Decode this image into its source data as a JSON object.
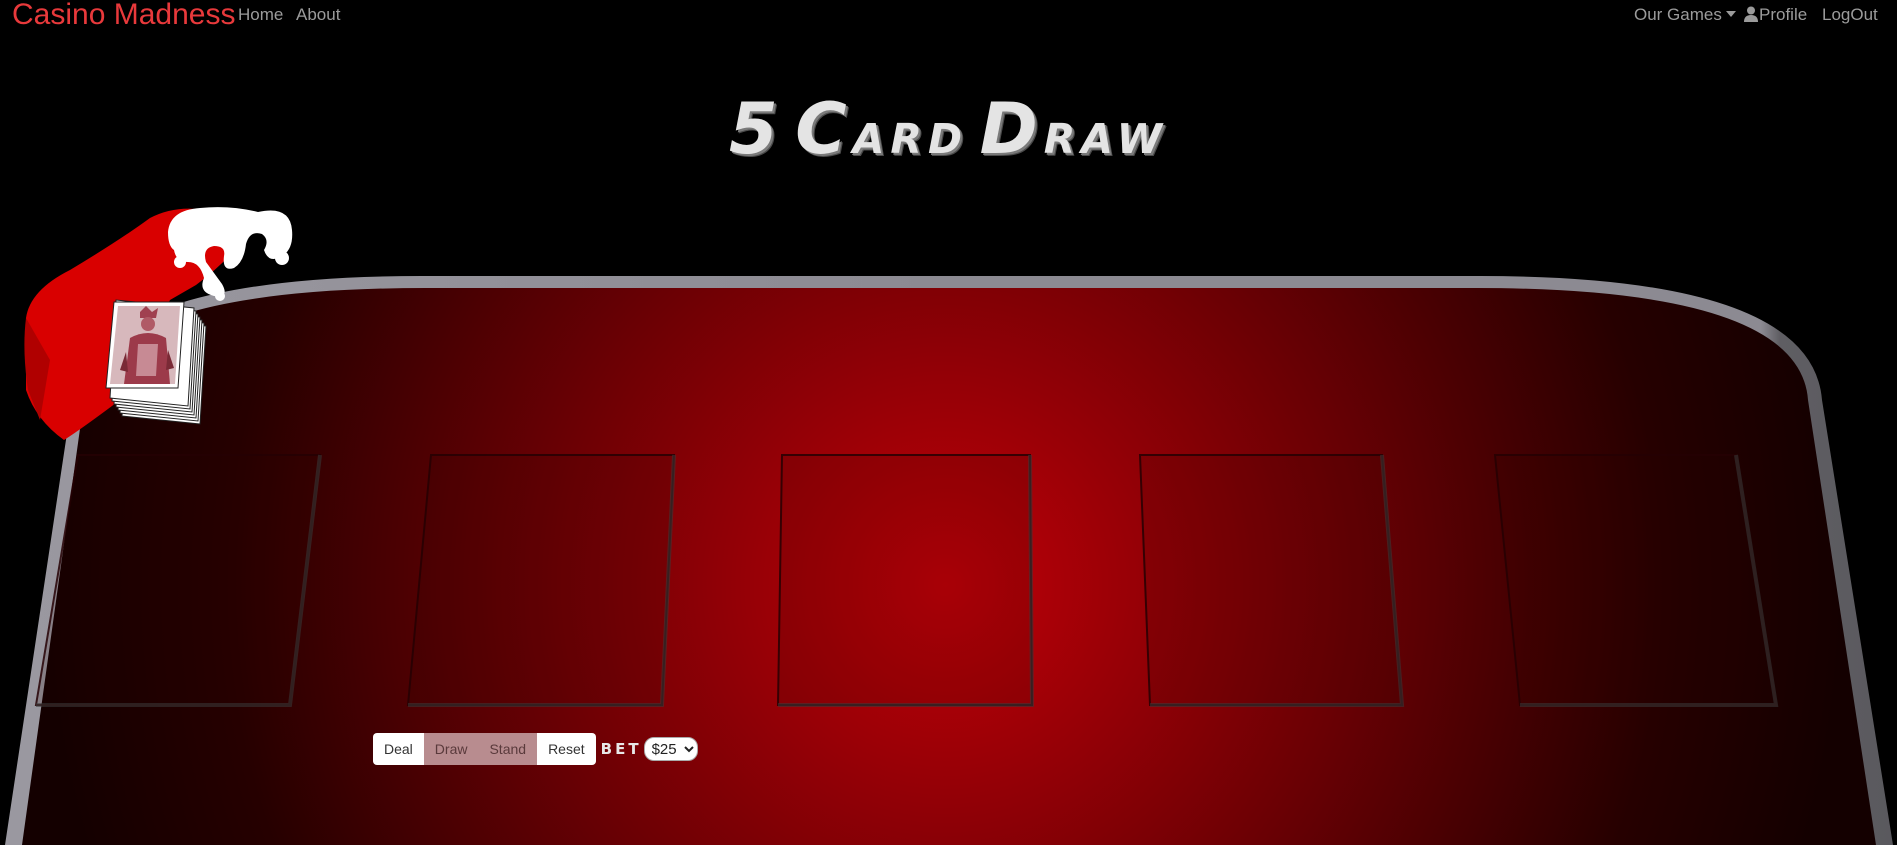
{
  "nav": {
    "brand": "Casino Madness",
    "home": "Home",
    "about": "About",
    "games": "Our Games",
    "profile": "Profile",
    "logout": "LogOut"
  },
  "title": {
    "number": "5",
    "word1_initial": "C",
    "word1_rest": "ard",
    "word2_initial": "D",
    "word2_rest": "raw"
  },
  "controls": {
    "deal": "Deal",
    "draw": "Draw",
    "stand": "Stand",
    "reset": "Reset",
    "bet_label": "BET",
    "bet_value": "$25",
    "bet_options": [
      "$25"
    ]
  },
  "colors": {
    "brand": "#e8393b",
    "felt_center": "#c00008",
    "felt_edge": "#1a0000",
    "rail": "#8d8a92",
    "button_disabled": "#b88c8f"
  },
  "card_slots_count": 5
}
